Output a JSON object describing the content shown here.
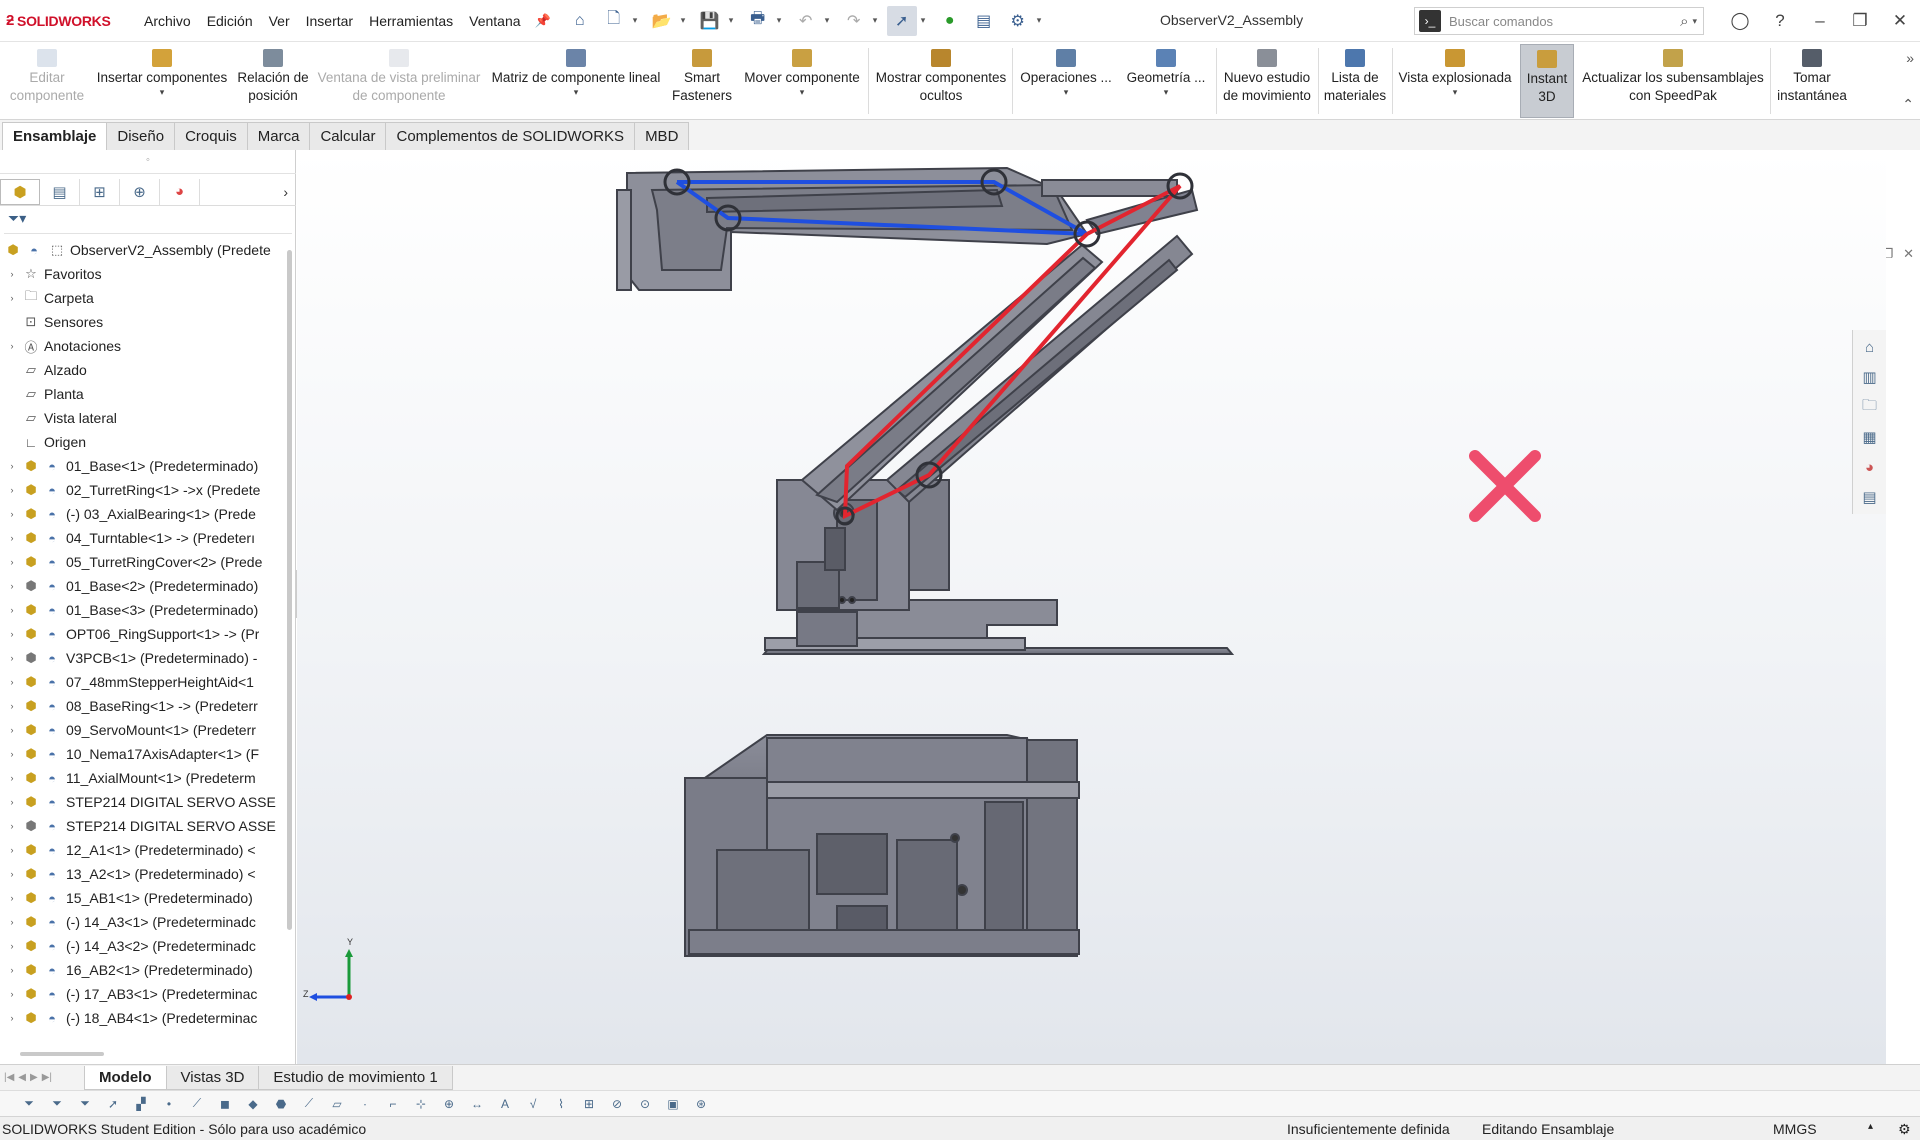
{
  "app": {
    "brand": "SOLIDWORKS",
    "menu": [
      "Archivo",
      "Edición",
      "Ver",
      "Insertar",
      "Herramientas",
      "Ventana"
    ],
    "document_title": "ObserverV2_Assembly",
    "search_placeholder": "Buscar comandos"
  },
  "commands": [
    {
      "label": "Editar componente",
      "enabled": false
    },
    {
      "label": "Insertar componentes",
      "enabled": true
    },
    {
      "label": "Relación de posición",
      "enabled": true
    },
    {
      "label": "Ventana de vista preliminar de componente",
      "enabled": false
    },
    {
      "label": "Matriz de componente lineal",
      "enabled": true
    },
    {
      "label": "Smart Fasteners",
      "enabled": true
    },
    {
      "label": "Mover componente",
      "enabled": true
    },
    {
      "label": "Mostrar componentes ocultos",
      "enabled": true
    },
    {
      "label": "Operaciones ...",
      "enabled": true
    },
    {
      "label": "Geometría ...",
      "enabled": true
    },
    {
      "label": "Nuevo estudio de movimiento",
      "enabled": true
    },
    {
      "label": "Lista de materiales",
      "enabled": true
    },
    {
      "label": "Vista explosionada",
      "enabled": true
    },
    {
      "label": "Instant 3D",
      "enabled": true,
      "active": true
    },
    {
      "label": "Actualizar los subensamblajes con SpeedPak",
      "enabled": true
    },
    {
      "label": "Tomar instantánea",
      "enabled": true
    }
  ],
  "tabs": [
    "Ensamblaje",
    "Diseño",
    "Croquis",
    "Marca",
    "Calcular",
    "Complementos de SOLIDWORKS",
    "MBD"
  ],
  "active_tab": "Ensamblaje",
  "tree": {
    "root": "ObserverV2_Assembly (Predete",
    "folders": [
      "Favoritos",
      "Carpeta",
      "Sensores",
      "Anotaciones",
      "Alzado",
      "Planta",
      "Vista lateral",
      "Origen"
    ],
    "components": [
      "01_Base<1> (Predeterminado)",
      "02_TurretRing<1> ->x (Predete",
      "(-) 03_AxialBearing<1> (Prede",
      "04_Turntable<1> -> (Predeterı",
      "05_TurretRingCover<2> (Prede",
      "01_Base<2> (Predeterminado)",
      "01_Base<3> (Predeterminado)",
      "OPT06_RingSupport<1> -> (Pr",
      "V3PCB<1> (Predeterminado) -",
      "07_48mmStepperHeightAid<1",
      "08_BaseRing<1> -> (Predeterr",
      "09_ServoMount<1> (Predeterr",
      "10_Nema17AxisAdapter<1> (F",
      "11_AxialMount<1> (Predeterm",
      "STEP214 DIGITAL SERVO ASSE",
      "STEP214 DIGITAL SERVO ASSE",
      "12_A1<1> (Predeterminado) <",
      "13_A2<1> (Predeterminado) <",
      "15_AB1<1> (Predeterminado)",
      "(-) 14_A3<1> (Predeterminadc",
      "(-) 14_A3<2> (Predeterminadc",
      "16_AB2<1> (Predeterminado)",
      "(-) 17_AB3<1> (Predeterminac",
      "(-) 18_AB4<1> (Predeterminac"
    ]
  },
  "bottom_tabs": [
    "Modelo",
    "Vistas 3D",
    "Estudio de movimiento 1"
  ],
  "active_bottom_tab": "Modelo",
  "status": {
    "edition": "SOLIDWORKS Student Edition - Sólo para uso académico",
    "definition": "Insuficientemente definida",
    "mode": "Editando Ensamblaje",
    "units": "MMGS"
  },
  "triad": {
    "y": "Y",
    "z": "Z"
  },
  "colors": {
    "linkage_blue": "#1f4fe0",
    "linkage_red": "#e2252f",
    "cross_pink": "#ee4d6d",
    "part_gray": "#7d7f8c",
    "brand_red": "#d0102a"
  }
}
